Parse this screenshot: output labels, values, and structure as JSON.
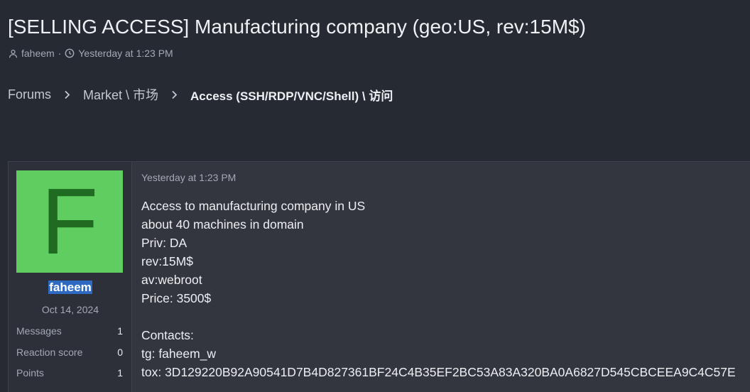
{
  "thread": {
    "title": "[SELLING ACCESS] Manufacturing company (geo:US, rev:15M$)",
    "author": "faheem",
    "separator": "·",
    "date": "Yesterday at 1:23 PM"
  },
  "breadcrumb": {
    "items": [
      "Forums",
      "Market \\ 市场",
      "Access (SSH/RDP/VNC/Shell) \\ 访问"
    ]
  },
  "post": {
    "avatar_letter": "F",
    "username": "faheem",
    "join_date": "Oct 14, 2024",
    "stats": [
      {
        "label": "Messages",
        "value": "1"
      },
      {
        "label": "Reaction score",
        "value": "0"
      },
      {
        "label": "Points",
        "value": "1"
      }
    ],
    "date": "Yesterday at 1:23 PM",
    "body": [
      "Access to manufacturing company in US",
      "about 40 machines in domain",
      "Priv: DA",
      "rev:15M$",
      "av:webroot",
      "Price: 3500$",
      "",
      "Contacts:",
      "tg: faheem_w",
      "tox: 3D129220B92A90541D7B4D827361BF24C4B35EF2BC53A83A320BA0A6827D545CBCEEA9C4C57E"
    ]
  },
  "colors": {
    "background": "#262a33",
    "avatar_bg": "#5fcd60",
    "avatar_letter": "#1f6b21",
    "username_highlight": "#2f6ac2"
  },
  "icons": [
    "user-icon",
    "clock-icon",
    "chevron-right-icon"
  ]
}
